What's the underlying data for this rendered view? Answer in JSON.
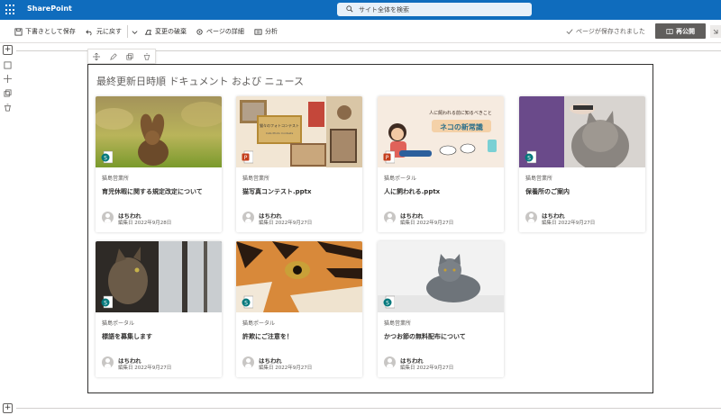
{
  "suite": {
    "brand": "SharePoint",
    "search_placeholder": "サイト全体を検索"
  },
  "commandbar": {
    "save_draft": "下書きとして保存",
    "undo": "元に戻す",
    "discard": "変更の破棄",
    "page_details": "ページの詳細",
    "analytics": "分析",
    "saved_status": "ページが保存されました",
    "republish": "再公開"
  },
  "webpart": {
    "title": "最終更新日時順 ドキュメント および ニュース",
    "cards": [
      {
        "site": "猫島営業所",
        "title": "育児休暇に関する規定改定について",
        "author": "はちわれ",
        "edited": "編集日 2022年9月28日",
        "file_type": "sharepoint-news",
        "thumb": "cat-heart-tail"
      },
      {
        "site": "猫島営業所",
        "title": "猫写真コンテスト.pptx",
        "author": "はちわれ",
        "edited": "編集日 2022年9月27日",
        "file_type": "powerpoint",
        "thumb": "photo-contest",
        "thumb_text": "猫々のフォトコンテスト",
        "thumb_subtext": "Cats Photo Contests"
      },
      {
        "site": "猫島ポータル",
        "title": "人に飼われる.pptx",
        "author": "はちわれ",
        "edited": "編集日 2022年9月27日",
        "file_type": "powerpoint",
        "thumb": "cat-illustration",
        "thumb_text": "人に飼われる前に知るべきこと",
        "thumb_subtext": "ネコの新常識"
      },
      {
        "site": "猫島営業所",
        "title": "保養所のご案内",
        "author": "はちわれ",
        "edited": "編集日 2022年9月27日",
        "file_type": "sharepoint-news",
        "thumb": "cat-brushed"
      },
      {
        "site": "猫島ポータル",
        "title": "標語を募集します",
        "author": "はちわれ",
        "edited": "編集日 2022年9月27日",
        "file_type": "sharepoint-news",
        "thumb": "cat-window"
      },
      {
        "site": "猫島ポータル",
        "title": "許欺にご注意を！",
        "author": "はちわれ",
        "edited": "編集日 2022年9月27日",
        "file_type": "sharepoint-news",
        "thumb": "tiger-eye"
      },
      {
        "site": "猫島営業所",
        "title": "かつお節の無料配布について",
        "author": "はちわれ",
        "edited": "編集日 2022年9月27日",
        "file_type": "sharepoint-news",
        "thumb": "grey-cat"
      }
    ]
  },
  "colors": {
    "suitebar": "#0f6cbd",
    "republish": "#605e5c",
    "sharepoint_badge": "#03787c",
    "powerpoint_badge": "#c43e1c"
  }
}
